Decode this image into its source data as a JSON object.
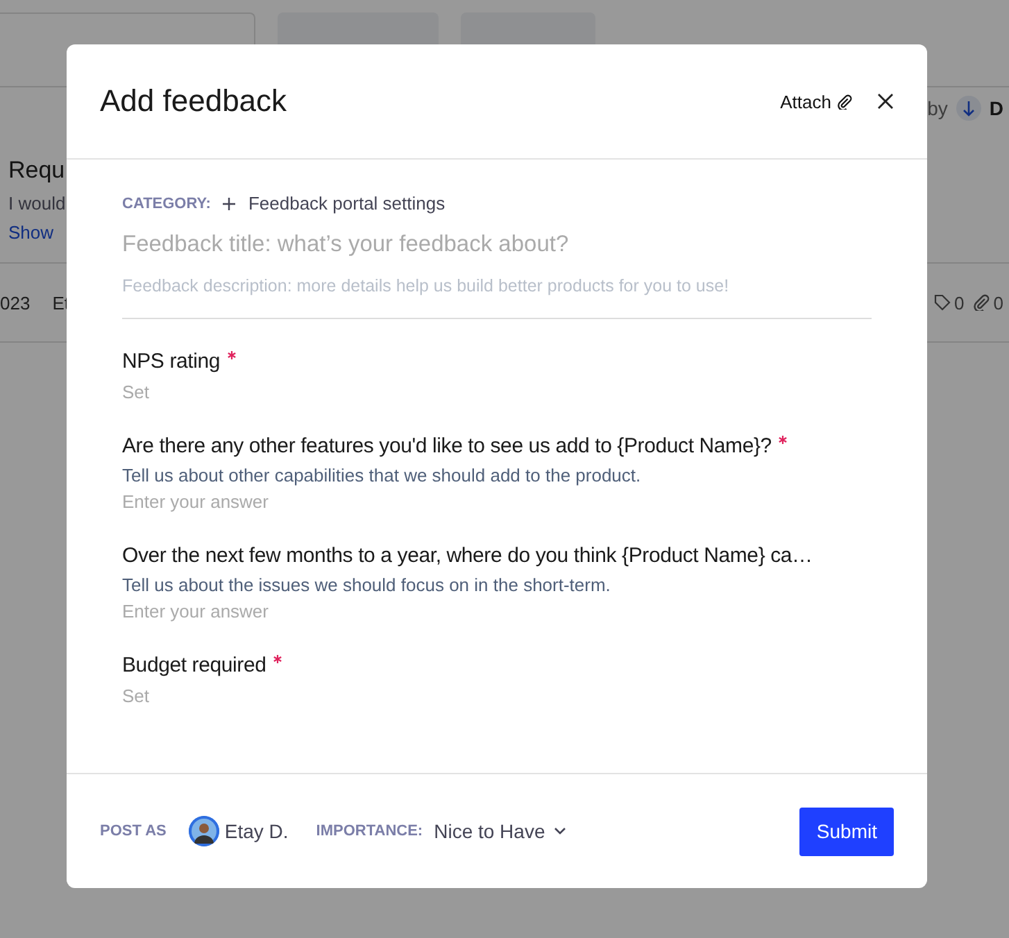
{
  "background": {
    "sort": {
      "prefix": "by",
      "value": "D"
    },
    "card": {
      "title": "Requ",
      "text": "I would",
      "link": "Show"
    },
    "row": {
      "date": "023",
      "author": "Et",
      "tags": "0",
      "attachments": "0"
    }
  },
  "modal": {
    "title": "Add feedback",
    "attach": "Attach",
    "category": {
      "label": "CATEGORY:",
      "value": "Feedback portal settings"
    },
    "title_field": {
      "placeholder": "Feedback title: what’s your feedback about?"
    },
    "description_field": {
      "placeholder": "Feedback description: more details help us build better products for you to use!"
    },
    "questions": [
      {
        "kind": "select",
        "label": "NPS rating",
        "required": true,
        "placeholder": "Set"
      },
      {
        "kind": "text",
        "label": "Are there any other features you'd like to see us add to {Product Name}?",
        "required": true,
        "description": "Tell us about other capabilities that we should add to the product.",
        "placeholder": "Enter your answer"
      },
      {
        "kind": "text",
        "label": "Over the next few months to a year, where do you think {Product Name} ca…",
        "required": false,
        "description": "Tell us about the issues we should focus on in the short-term.",
        "placeholder": "Enter your answer"
      },
      {
        "kind": "select",
        "label": "Budget required",
        "required": true,
        "placeholder": "Set"
      }
    ],
    "footer": {
      "post_as_label": "POST AS",
      "user": "Etay D.",
      "importance_label": "IMPORTANCE:",
      "importance": "Nice to Have",
      "submit": "Submit"
    }
  }
}
